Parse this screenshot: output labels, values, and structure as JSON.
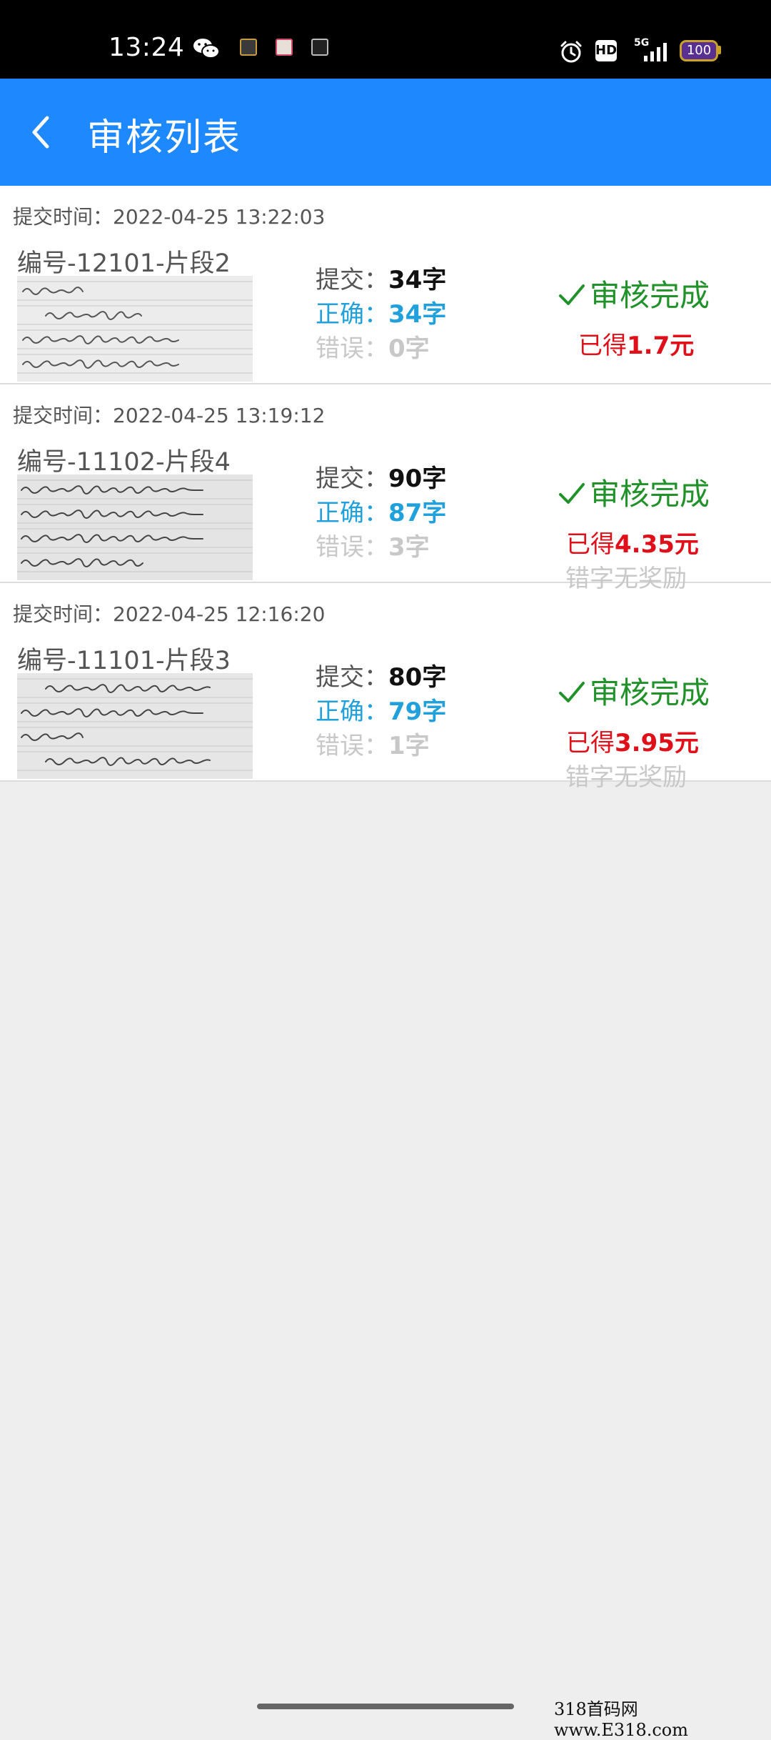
{
  "status_bar": {
    "time": "13:24",
    "network": "5G",
    "hd": "HD",
    "battery": "100",
    "icons": [
      "wechat-icon",
      "notification-icon",
      "alarm-icon",
      "signal-icon",
      "battery-icon"
    ]
  },
  "app_bar": {
    "title": "审核列表",
    "back_icon": "chevron-left-icon"
  },
  "items": [
    {
      "submit_time": "提交时间：2022-04-25 13:22:03",
      "id": "编号-12101-片段2",
      "submitted_label": "提交：",
      "submitted_value": "34字",
      "correct_label": "正确：",
      "correct_value": "34字",
      "error_label": "错误：",
      "error_value": "0字",
      "status": "审核完成",
      "earned_label": "已得",
      "earned_value": "1.7元",
      "no_reward": ""
    },
    {
      "submit_time": "提交时间：2022-04-25 13:19:12",
      "id": "编号-11102-片段4",
      "submitted_label": "提交：",
      "submitted_value": "90字",
      "correct_label": "正确：",
      "correct_value": "87字",
      "error_label": "错误：",
      "error_value": "3字",
      "status": "审核完成",
      "earned_label": "已得",
      "earned_value": "4.35元",
      "no_reward": "错字无奖励"
    },
    {
      "submit_time": "提交时间：2022-04-25 12:16:20",
      "id": "编号-11101-片段3",
      "submitted_label": "提交：",
      "submitted_value": "80字",
      "correct_label": "正确：",
      "correct_value": "79字",
      "error_label": "错误：",
      "error_value": "1字",
      "status": "审核完成",
      "earned_label": "已得",
      "earned_value": "3.95元",
      "no_reward": "错字无奖励"
    }
  ],
  "colors": {
    "app_bar": "#1e88ff",
    "status_done": "#21922a",
    "correct": "#21a1dc",
    "earned": "#e0101a",
    "muted": "#c8c8c8"
  },
  "watermark": "318首码网 www.E318.com"
}
